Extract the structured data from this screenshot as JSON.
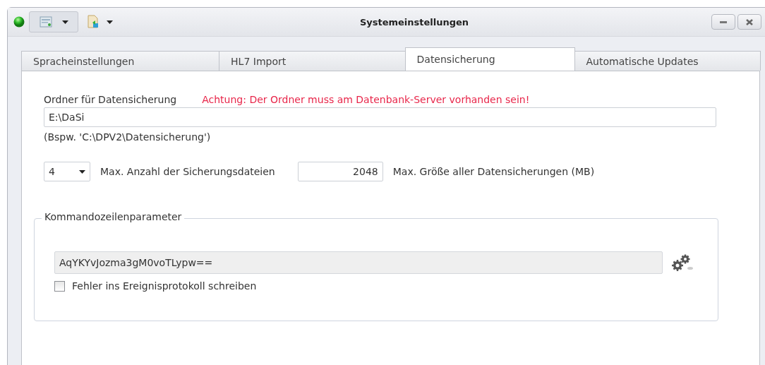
{
  "window": {
    "title": "Systemeinstellungen"
  },
  "tabs": [
    {
      "label": "Spracheinstellungen",
      "selected": false
    },
    {
      "label": "HL7 Import",
      "selected": false
    },
    {
      "label": "Datensicherung",
      "selected": true
    },
    {
      "label": "Automatische Updates",
      "selected": false
    }
  ],
  "backup_folder": {
    "label": "Ordner für Datensicherung",
    "warning": "Achtung: Der Ordner muss am Datenbank-Server vorhanden sein!",
    "value": "E:\\DaSi",
    "hint": "(Bspw. 'C:\\DPV2\\Datensicherung')"
  },
  "max_files": {
    "value": "4",
    "label": "Max. Anzahl der Sicherungsdateien"
  },
  "max_size": {
    "value": "2048",
    "label": "Max. Größe aller Datensicherungen (MB)"
  },
  "command_line": {
    "title": "Kommandozeilenparameter",
    "value": "AqYKYvJozma3gM0voTLypw==",
    "log_errors": {
      "label": "Fehler ins Ereignisprotokoll schreiben",
      "checked": false
    }
  }
}
